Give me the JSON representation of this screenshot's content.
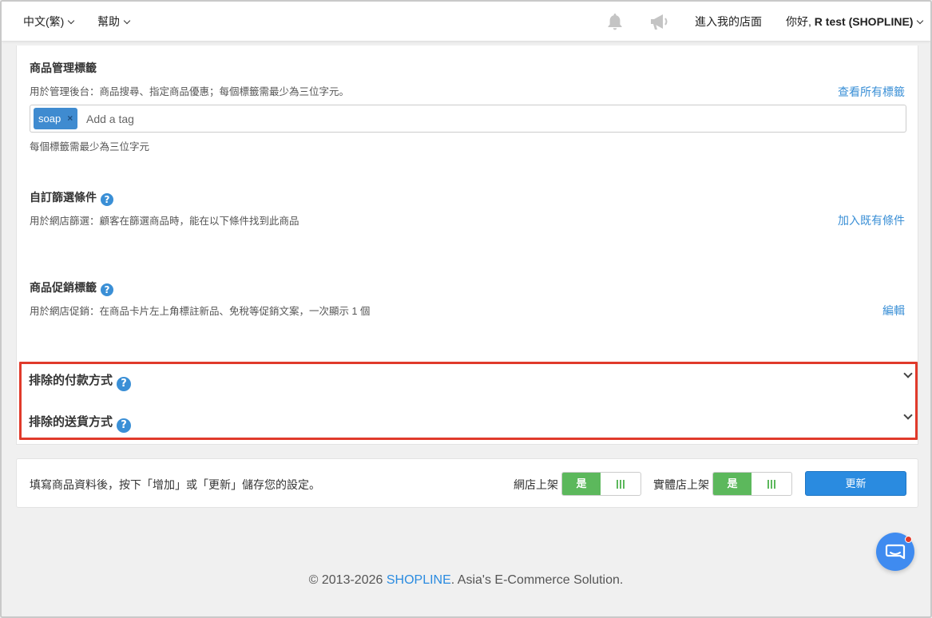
{
  "nav": {
    "language": "中文(繁)",
    "help": "幫助",
    "enter_store": "進入我的店面",
    "greeting_prefix": "你好, ",
    "greeting_name": "R test (SHOPLINE)",
    "icons": [
      "bell-icon",
      "megaphone-icon"
    ]
  },
  "tags_section": {
    "title": "商品管理標籤",
    "desc": "用於管理後台：商品搜尋、指定商品優惠；每個標籤需最少為三位字元。",
    "view_all": "查看所有標籤",
    "chip": "soap",
    "chip_remove": "×",
    "placeholder": "Add a tag",
    "hint": "每個標籤需最少為三位字元"
  },
  "filter_section": {
    "title": "自訂篩選條件",
    "desc": "用於網店篩選：顧客在篩選商品時，能在以下條件找到此商品",
    "link": "加入既有條件"
  },
  "promo_section": {
    "title": "商品促銷標籤",
    "desc": "用於網店促銷：在商品卡片左上角標註新品、免稅等促銷文案，一次顯示 1 個",
    "link": "編輯"
  },
  "collapsibles": {
    "payment": "排除的付款方式",
    "delivery": "排除的送貨方式"
  },
  "actionbar": {
    "hint": "填寫商品資料後，按下「增加」或「更新」儲存您的設定。",
    "online_label": "網店上架",
    "retail_label": "實體店上架",
    "yes": "是",
    "update": "更新"
  },
  "footer": {
    "prefix": "© 2013-2026 ",
    "brand": "SHOPLINE",
    "suffix": ". Asia's E-Commerce Solution."
  },
  "help_glyph": "?",
  "colors": {
    "accent": "#3a8fd6",
    "toggle_on": "#5cb85c",
    "highlight": "#e03a2b",
    "button": "#2a8be0"
  }
}
